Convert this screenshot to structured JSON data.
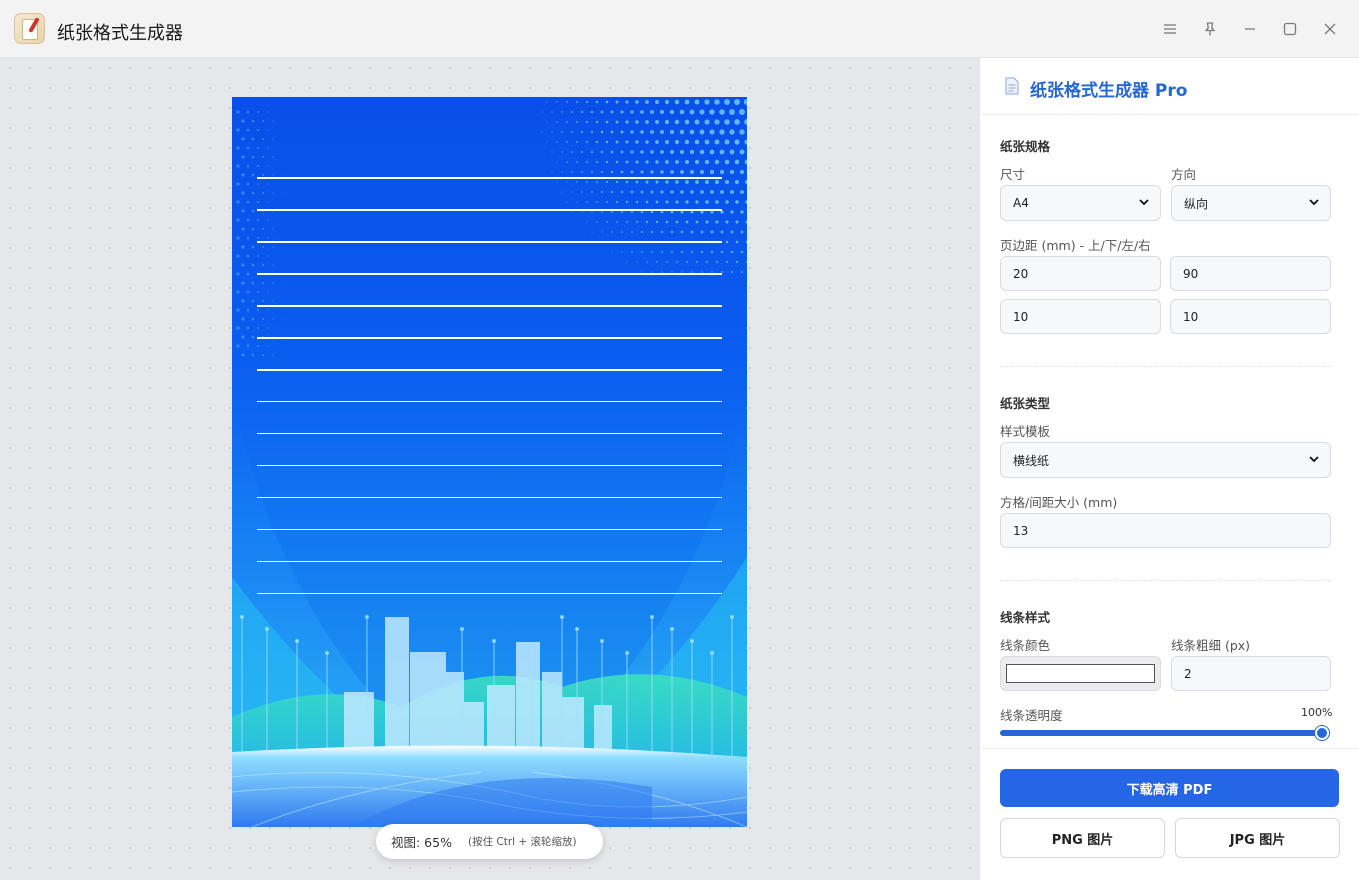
{
  "window": {
    "title": "纸张格式生成器"
  },
  "preview": {
    "zoom_label": "视图: 65%",
    "zoom_hint": "(按住 Ctrl + 滚轮缩放)"
  },
  "panel": {
    "title": "纸张格式生成器 Pro",
    "paper_spec": {
      "section_title": "纸张规格",
      "size_label": "尺寸",
      "size_value": "A4",
      "orientation_label": "方向",
      "orientation_value": "纵向",
      "margins_label": "页边距 (mm) - 上/下/左/右",
      "margin_top": "20",
      "margin_bottom": "90",
      "margin_left": "10",
      "margin_right": "10"
    },
    "paper_type": {
      "section_title": "纸张类型",
      "template_label": "样式模板",
      "template_value": "横线纸",
      "spacing_label": "方格/间距大小 (mm)",
      "spacing_value": "13"
    },
    "line_style": {
      "section_title": "线条样式",
      "color_label": "线条颜色",
      "color_value": "#ffffff",
      "width_label": "线条粗细 (px)",
      "width_value": "2",
      "opacity_label": "线条透明度",
      "opacity_value": "100%",
      "opacity_fraction": 1.0
    },
    "actions": {
      "download_pdf": "下载高清 PDF",
      "png": "PNG 图片",
      "jpg": "JPG 图片"
    }
  },
  "colors": {
    "accent": "#2566e6",
    "paper_blue": "#0b5cf0"
  },
  "icons": [
    "app-icon",
    "menu-icon",
    "pin-icon",
    "minimize-icon",
    "maximize-icon",
    "close-icon",
    "document-icon",
    "chevron-down-icon"
  ]
}
